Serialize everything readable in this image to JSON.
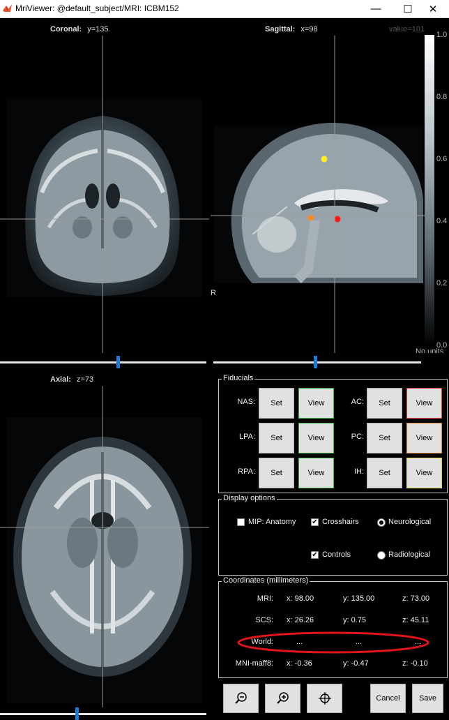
{
  "window": {
    "title": "MriViewer: @default_subject/MRI: ICBM152",
    "minimize": "—",
    "maximize": "☐",
    "close": "✕"
  },
  "views": {
    "coronal": {
      "name": "Coronal:",
      "coord": "y=135"
    },
    "sagittal": {
      "name": "Sagittal:",
      "coord": "x=98",
      "value": "value=101",
      "orient": "R"
    },
    "axial": {
      "name": "Axial:",
      "coord": "z=73"
    }
  },
  "colorbar": {
    "ticks": [
      "1.0",
      "0.8",
      "0.6",
      "0.4",
      "0.2",
      "0.0"
    ],
    "units": "No units"
  },
  "sliders": {
    "coronal_level": 0.57,
    "sagittal_level": 0.49,
    "axial_level": 0.37
  },
  "fiducials": {
    "title": "Fiducials",
    "rows": [
      {
        "left_label": "NAS:",
        "right_label": "AC:",
        "right_color": "#e04040"
      },
      {
        "left_label": "LPA:",
        "right_label": "PC:",
        "right_color": "#e08a30"
      },
      {
        "left_label": "RPA:",
        "right_label": "IH:",
        "right_color": "#e6d83a"
      }
    ],
    "set_label": "Set",
    "view_label": "View",
    "left_view_color": "#3faf4a"
  },
  "markers": {
    "ac_color": "#ff1a1a",
    "pc_color": "#ff8a1a",
    "ih_color": "#ffee22"
  },
  "display_options": {
    "title": "Display options",
    "mip": {
      "label": "MIP: Anatomy",
      "checked": false
    },
    "crosshairs": {
      "label": "Crosshairs",
      "checked": true
    },
    "controls": {
      "label": "Controls",
      "checked": true
    },
    "neurological": {
      "label": "Neurological",
      "selected": true
    },
    "radiological": {
      "label": "Radiological",
      "selected": false
    }
  },
  "coordinates": {
    "title": "Coordinates (millimeters)",
    "rows": [
      {
        "label": "MRI:",
        "x": "x: 98.00",
        "y": "y: 135.00",
        "z": "z: 73.00"
      },
      {
        "label": "SCS:",
        "x": "x: 26.26",
        "y": "y: 0.75",
        "z": "z: 45.11"
      },
      {
        "label": "World:",
        "x": "...",
        "y": "...",
        "z": "..."
      },
      {
        "label": "MNI-maff8:",
        "x": "x: -0.36",
        "y": "y: -0.47",
        "z": "z: -0.10"
      }
    ],
    "highlight_color": "#e0141a"
  },
  "toolbar": {
    "zoom_out_icon": "zoom-out-icon",
    "zoom_in_icon": "zoom-in-icon",
    "center_icon": "crosshair-target-icon",
    "cancel": "Cancel",
    "save": "Save"
  }
}
